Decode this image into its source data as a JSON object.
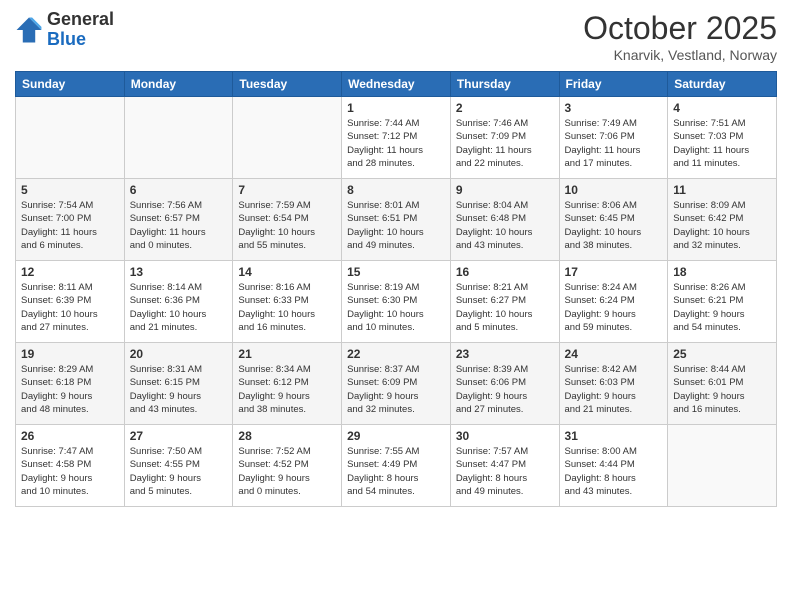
{
  "logo": {
    "general": "General",
    "blue": "Blue"
  },
  "header": {
    "month": "October 2025",
    "location": "Knarvik, Vestland, Norway"
  },
  "weekdays": [
    "Sunday",
    "Monday",
    "Tuesday",
    "Wednesday",
    "Thursday",
    "Friday",
    "Saturday"
  ],
  "weeks": [
    [
      {
        "day": "",
        "info": ""
      },
      {
        "day": "",
        "info": ""
      },
      {
        "day": "",
        "info": ""
      },
      {
        "day": "1",
        "info": "Sunrise: 7:44 AM\nSunset: 7:12 PM\nDaylight: 11 hours\nand 28 minutes."
      },
      {
        "day": "2",
        "info": "Sunrise: 7:46 AM\nSunset: 7:09 PM\nDaylight: 11 hours\nand 22 minutes."
      },
      {
        "day": "3",
        "info": "Sunrise: 7:49 AM\nSunset: 7:06 PM\nDaylight: 11 hours\nand 17 minutes."
      },
      {
        "day": "4",
        "info": "Sunrise: 7:51 AM\nSunset: 7:03 PM\nDaylight: 11 hours\nand 11 minutes."
      }
    ],
    [
      {
        "day": "5",
        "info": "Sunrise: 7:54 AM\nSunset: 7:00 PM\nDaylight: 11 hours\nand 6 minutes."
      },
      {
        "day": "6",
        "info": "Sunrise: 7:56 AM\nSunset: 6:57 PM\nDaylight: 11 hours\nand 0 minutes."
      },
      {
        "day": "7",
        "info": "Sunrise: 7:59 AM\nSunset: 6:54 PM\nDaylight: 10 hours\nand 55 minutes."
      },
      {
        "day": "8",
        "info": "Sunrise: 8:01 AM\nSunset: 6:51 PM\nDaylight: 10 hours\nand 49 minutes."
      },
      {
        "day": "9",
        "info": "Sunrise: 8:04 AM\nSunset: 6:48 PM\nDaylight: 10 hours\nand 43 minutes."
      },
      {
        "day": "10",
        "info": "Sunrise: 8:06 AM\nSunset: 6:45 PM\nDaylight: 10 hours\nand 38 minutes."
      },
      {
        "day": "11",
        "info": "Sunrise: 8:09 AM\nSunset: 6:42 PM\nDaylight: 10 hours\nand 32 minutes."
      }
    ],
    [
      {
        "day": "12",
        "info": "Sunrise: 8:11 AM\nSunset: 6:39 PM\nDaylight: 10 hours\nand 27 minutes."
      },
      {
        "day": "13",
        "info": "Sunrise: 8:14 AM\nSunset: 6:36 PM\nDaylight: 10 hours\nand 21 minutes."
      },
      {
        "day": "14",
        "info": "Sunrise: 8:16 AM\nSunset: 6:33 PM\nDaylight: 10 hours\nand 16 minutes."
      },
      {
        "day": "15",
        "info": "Sunrise: 8:19 AM\nSunset: 6:30 PM\nDaylight: 10 hours\nand 10 minutes."
      },
      {
        "day": "16",
        "info": "Sunrise: 8:21 AM\nSunset: 6:27 PM\nDaylight: 10 hours\nand 5 minutes."
      },
      {
        "day": "17",
        "info": "Sunrise: 8:24 AM\nSunset: 6:24 PM\nDaylight: 9 hours\nand 59 minutes."
      },
      {
        "day": "18",
        "info": "Sunrise: 8:26 AM\nSunset: 6:21 PM\nDaylight: 9 hours\nand 54 minutes."
      }
    ],
    [
      {
        "day": "19",
        "info": "Sunrise: 8:29 AM\nSunset: 6:18 PM\nDaylight: 9 hours\nand 48 minutes."
      },
      {
        "day": "20",
        "info": "Sunrise: 8:31 AM\nSunset: 6:15 PM\nDaylight: 9 hours\nand 43 minutes."
      },
      {
        "day": "21",
        "info": "Sunrise: 8:34 AM\nSunset: 6:12 PM\nDaylight: 9 hours\nand 38 minutes."
      },
      {
        "day": "22",
        "info": "Sunrise: 8:37 AM\nSunset: 6:09 PM\nDaylight: 9 hours\nand 32 minutes."
      },
      {
        "day": "23",
        "info": "Sunrise: 8:39 AM\nSunset: 6:06 PM\nDaylight: 9 hours\nand 27 minutes."
      },
      {
        "day": "24",
        "info": "Sunrise: 8:42 AM\nSunset: 6:03 PM\nDaylight: 9 hours\nand 21 minutes."
      },
      {
        "day": "25",
        "info": "Sunrise: 8:44 AM\nSunset: 6:01 PM\nDaylight: 9 hours\nand 16 minutes."
      }
    ],
    [
      {
        "day": "26",
        "info": "Sunrise: 7:47 AM\nSunset: 4:58 PM\nDaylight: 9 hours\nand 10 minutes."
      },
      {
        "day": "27",
        "info": "Sunrise: 7:50 AM\nSunset: 4:55 PM\nDaylight: 9 hours\nand 5 minutes."
      },
      {
        "day": "28",
        "info": "Sunrise: 7:52 AM\nSunset: 4:52 PM\nDaylight: 9 hours\nand 0 minutes."
      },
      {
        "day": "29",
        "info": "Sunrise: 7:55 AM\nSunset: 4:49 PM\nDaylight: 8 hours\nand 54 minutes."
      },
      {
        "day": "30",
        "info": "Sunrise: 7:57 AM\nSunset: 4:47 PM\nDaylight: 8 hours\nand 49 minutes."
      },
      {
        "day": "31",
        "info": "Sunrise: 8:00 AM\nSunset: 4:44 PM\nDaylight: 8 hours\nand 43 minutes."
      },
      {
        "day": "",
        "info": ""
      }
    ]
  ]
}
